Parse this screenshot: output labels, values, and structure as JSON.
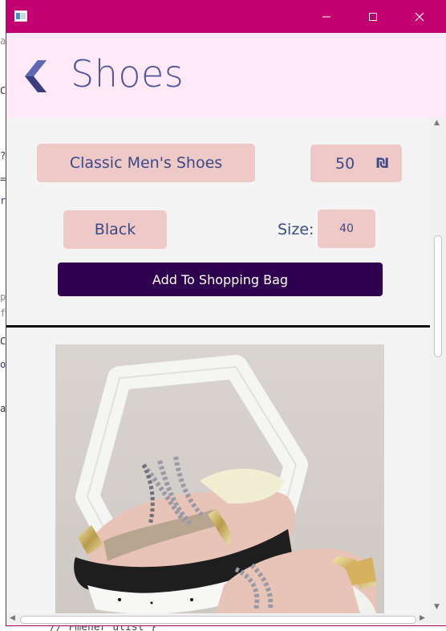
{
  "window": {
    "title_bar_color": "#c2006f",
    "controls": {
      "minimize": "—",
      "maximize": "☐",
      "close": "✕"
    }
  },
  "header": {
    "title": "Shoes",
    "back_icon": "chevron-left-icon"
  },
  "product": {
    "name": "Classic Men's Shoes",
    "price": "50",
    "currency": "₪",
    "color": "Black",
    "size_label": "Size:",
    "size": "40",
    "add_button": "Add To Shopping Bag"
  },
  "colors": {
    "accent": "#c2006f",
    "header_bg": "#fde9f7",
    "pill_bg": "#efc8c8",
    "button_bg": "#300050",
    "text": "#3b4a86"
  }
}
